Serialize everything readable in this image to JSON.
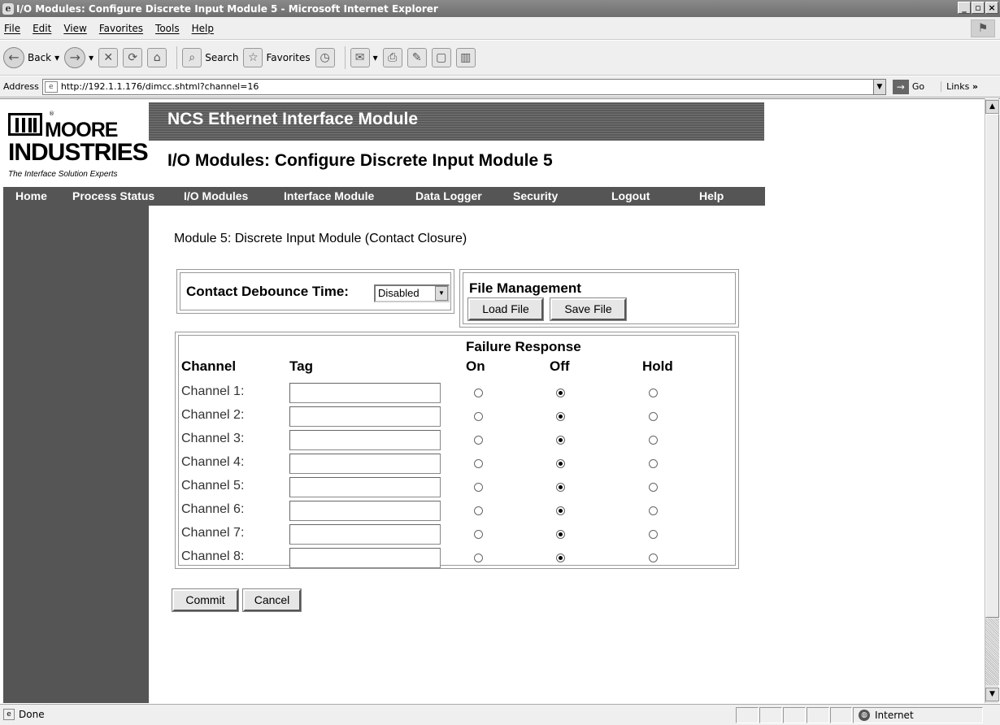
{
  "window": {
    "title": "I/O Modules: Configure Discrete Input Module 5 - Microsoft Internet Explorer"
  },
  "menu": [
    "File",
    "Edit",
    "View",
    "Favorites",
    "Tools",
    "Help"
  ],
  "toolbar": {
    "back": "Back",
    "search": "Search",
    "favorites": "Favorites"
  },
  "address": {
    "label": "Address",
    "url": "http://192.1.1.176/dimcc.shtml?channel=16",
    "go": "Go",
    "links": "Links"
  },
  "logo": {
    "line1": "MOORE",
    "line2": "INDUSTRIES",
    "tagline": "The Interface Solution Experts",
    "reg": "®"
  },
  "banner": {
    "title": "NCS Ethernet Interface Module"
  },
  "page": {
    "title": "I/O Modules: Configure Discrete Input Module 5"
  },
  "nav": [
    "Home",
    "Process Status",
    "I/O Modules",
    "Interface Module",
    "Data Logger",
    "Security",
    "Logout",
    "Help"
  ],
  "module": {
    "heading": "Module 5: Discrete Input Module (Contact Closure)"
  },
  "debounce": {
    "label": "Contact Debounce Time:",
    "value": "Disabled"
  },
  "file_management": {
    "label": "File Management",
    "load": "Load File",
    "save": "Save File"
  },
  "table": {
    "failure_response": "Failure Response",
    "headers": {
      "channel": "Channel",
      "tag": "Tag",
      "on": "On",
      "off": "Off",
      "hold": "Hold"
    },
    "rows": [
      {
        "label": "Channel 1:",
        "tag": "",
        "selected": "off"
      },
      {
        "label": "Channel 2:",
        "tag": "",
        "selected": "off"
      },
      {
        "label": "Channel 3:",
        "tag": "",
        "selected": "off"
      },
      {
        "label": "Channel 4:",
        "tag": "",
        "selected": "off"
      },
      {
        "label": "Channel 5:",
        "tag": "",
        "selected": "off"
      },
      {
        "label": "Channel 6:",
        "tag": "",
        "selected": "off"
      },
      {
        "label": "Channel 7:",
        "tag": "",
        "selected": "off"
      },
      {
        "label": "Channel 8:",
        "tag": "",
        "selected": "off"
      }
    ]
  },
  "actions": {
    "commit": "Commit",
    "cancel": "Cancel"
  },
  "status": {
    "text": "Done",
    "zone": "Internet"
  }
}
